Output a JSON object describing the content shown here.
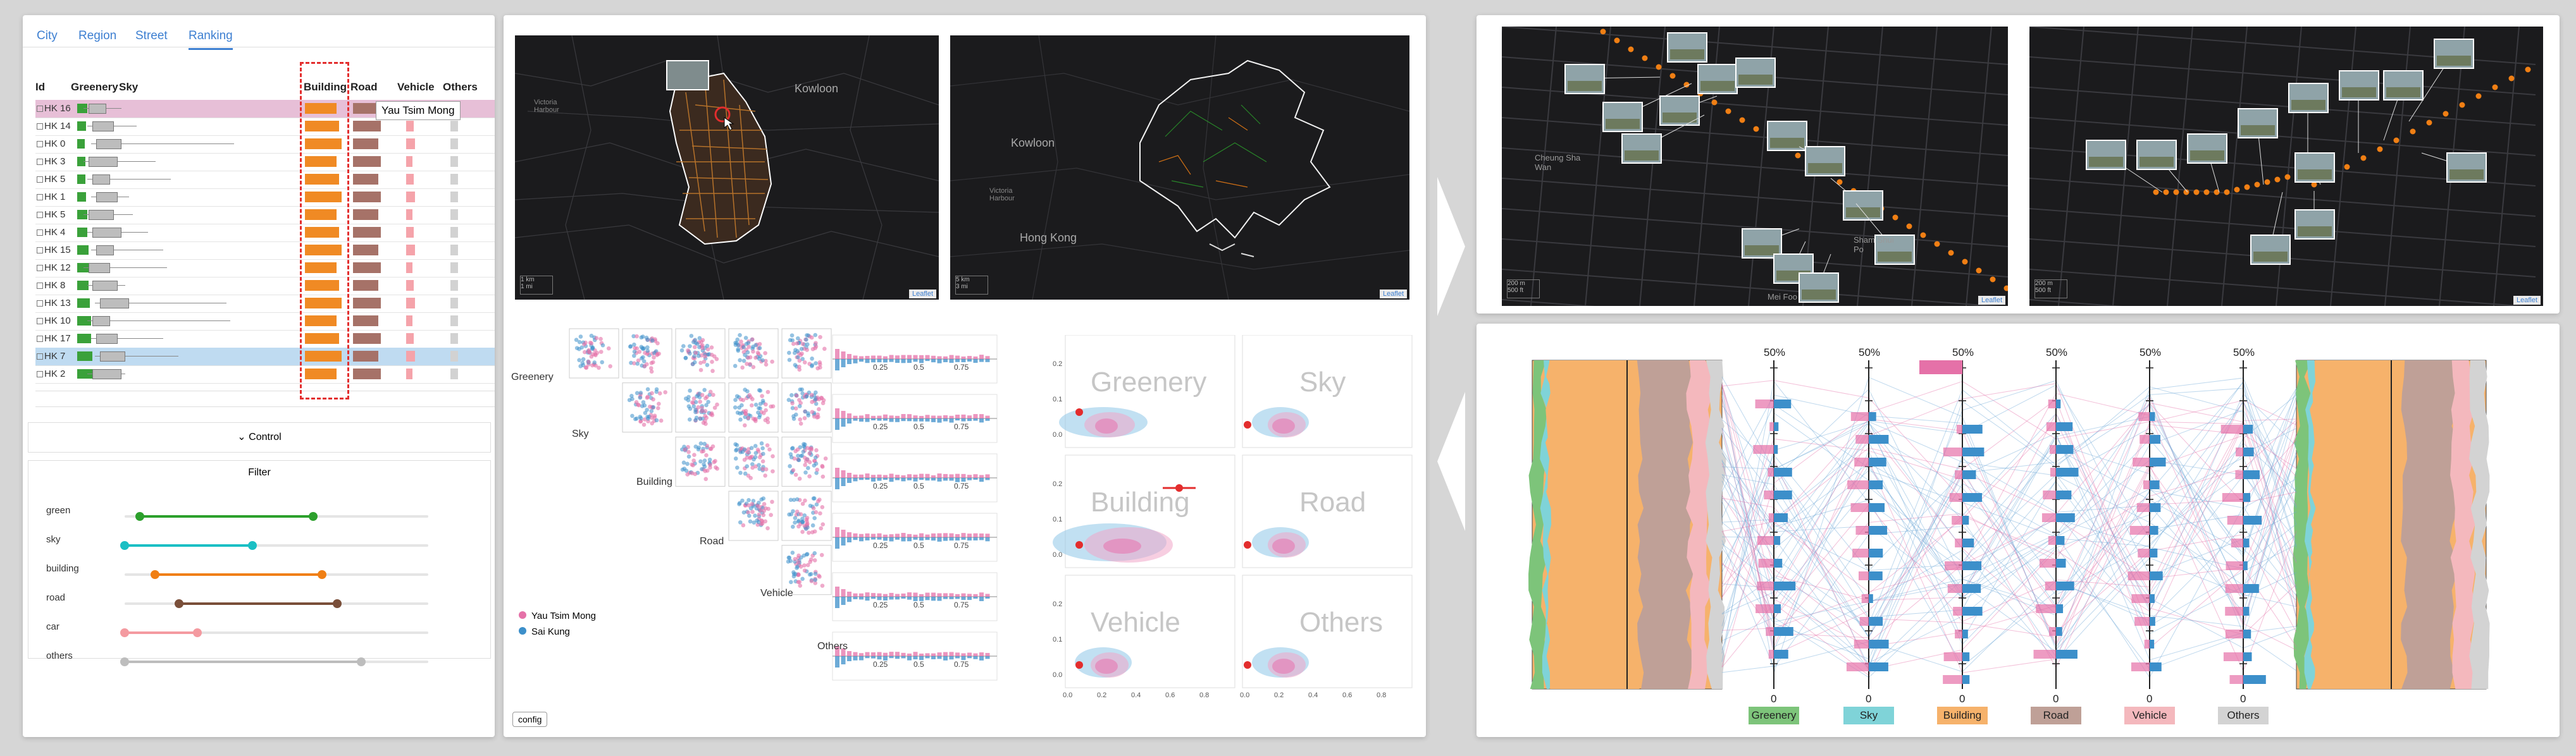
{
  "ranking_panel": {
    "tabs": [
      {
        "label": "City",
        "active": false
      },
      {
        "label": "Region",
        "active": false
      },
      {
        "label": "Street",
        "active": false
      },
      {
        "label": "Ranking",
        "active": true
      }
    ],
    "columns": [
      "Id",
      "Greenery",
      "Sky",
      "Building",
      "Road",
      "Vehicle",
      "Others"
    ],
    "rows": [
      {
        "id": "HK 16",
        "green": 0.2,
        "highlight": "pink"
      },
      {
        "id": "HK 14",
        "green": 0.18,
        "highlight": "none"
      },
      {
        "id": "HK 0",
        "green": 0.15,
        "highlight": "none"
      },
      {
        "id": "HK 3",
        "green": 0.16,
        "highlight": "none"
      },
      {
        "id": "HK 5",
        "green": 0.16,
        "highlight": "none"
      },
      {
        "id": "HK 1",
        "green": 0.17,
        "highlight": "none"
      },
      {
        "id": "HK 5",
        "green": 0.2,
        "highlight": "none"
      },
      {
        "id": "HK 4",
        "green": 0.2,
        "highlight": "none"
      },
      {
        "id": "HK 15",
        "green": 0.22,
        "highlight": "none"
      },
      {
        "id": "HK 12",
        "green": 0.22,
        "highlight": "none"
      },
      {
        "id": "HK 8",
        "green": 0.22,
        "highlight": "none"
      },
      {
        "id": "HK 13",
        "green": 0.25,
        "highlight": "none"
      },
      {
        "id": "HK 10",
        "green": 0.28,
        "highlight": "none"
      },
      {
        "id": "HK 17",
        "green": 0.28,
        "highlight": "none"
      },
      {
        "id": "HK 7",
        "green": 0.3,
        "highlight": "blue"
      },
      {
        "id": "HK 2",
        "green": 0.3,
        "highlight": "none"
      }
    ],
    "tooltip": "Yau Tsim Mong",
    "control_label": "Control",
    "filter_label": "Filter",
    "sliders": [
      {
        "label": "green",
        "color": "#2ca02c",
        "min": 0.05,
        "max": 0.62
      },
      {
        "label": "sky",
        "color": "#1bbfc4",
        "min": 0.0,
        "max": 0.42
      },
      {
        "label": "building",
        "color": "#f07f14",
        "min": 0.1,
        "max": 0.65
      },
      {
        "label": "road",
        "color": "#7a4f3a",
        "min": 0.18,
        "max": 0.7
      },
      {
        "label": "car",
        "color": "#f49aa0",
        "min": 0.0,
        "max": 0.24
      },
      {
        "label": "others",
        "color": "#bdbdbd",
        "min": 0.0,
        "max": 0.78
      }
    ]
  },
  "map_left": {
    "labels": [
      "Kowloon",
      "Victoria Harbour"
    ],
    "scale": [
      "1 km",
      "1 mi"
    ],
    "attribution": "Leaflet"
  },
  "map_right": {
    "labels": [
      "Kowloon",
      "Hong Kong",
      "Victoria Harbour"
    ],
    "scale": [
      "5 km",
      "3 mi"
    ],
    "attribution": "Leaflet"
  },
  "scatter_matrix": {
    "row_labels": [
      "Greenery",
      "Sky",
      "Building",
      "Road",
      "Vehicle",
      "Others"
    ],
    "legend": [
      {
        "label": "Yau Tsim Mong",
        "color": "#e571a8"
      },
      {
        "label": "Sai Kung",
        "color": "#3c8fca"
      }
    ],
    "hist_ticks": [
      "0.25",
      "0.5",
      "0.75"
    ],
    "config_button": "config"
  },
  "density_panel": {
    "titles": [
      "Greenery",
      "Sky",
      "Building",
      "Road",
      "Vehicle",
      "Others"
    ],
    "x_ticks": [
      "0.0",
      "0.2",
      "0.4",
      "0.6",
      "0.8"
    ],
    "y_ticks": [
      "0.2",
      "0.1",
      "0.0"
    ]
  },
  "street_maps": {
    "left_labels": [
      "Cheung Sha Wan",
      "Sham Shui Po",
      "Mei Foo"
    ],
    "attribution": "Leaflet",
    "scale": [
      "200 m",
      "500 ft"
    ]
  },
  "parallel_panel": {
    "categories": [
      {
        "label": "Greenery",
        "color": "#7dc47a"
      },
      {
        "label": "Sky",
        "color": "#7fd3d8"
      },
      {
        "label": "Building",
        "color": "#f6b26b"
      },
      {
        "label": "Road",
        "color": "#bfa097"
      },
      {
        "label": "Vehicle",
        "color": "#f4b8bd"
      },
      {
        "label": "Others",
        "color": "#d3d3d3"
      }
    ],
    "top_label": "50%",
    "bottom_label": "0"
  }
}
